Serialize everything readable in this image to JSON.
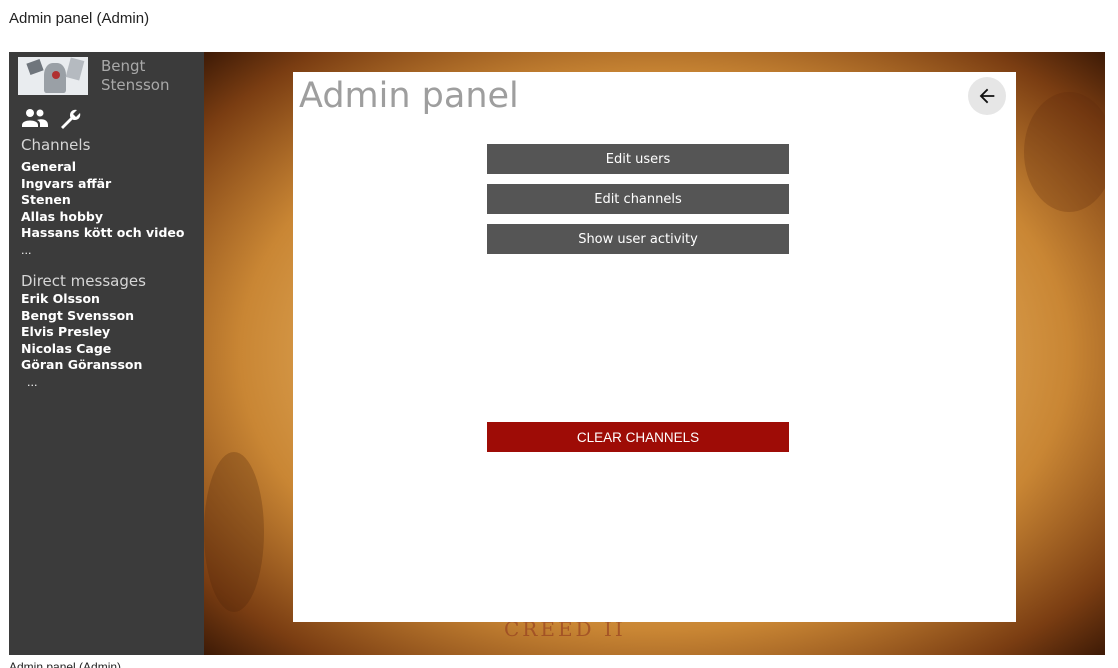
{
  "page_caption": "Admin panel (Admin)",
  "footer_caption": "Admin panel (Admin)",
  "sidebar": {
    "user_name_line1": "Bengt",
    "user_name_line2": "Stensson",
    "tool_icons": [
      "users-icon",
      "wrench-icon"
    ],
    "channels_heading": "Channels",
    "channels": [
      "General",
      "Ingvars affär",
      "Stenen",
      "Allas hobby",
      "Hassans kött och video",
      "..."
    ],
    "dm_heading": "Direct messages",
    "direct_messages": [
      "Erik Olsson",
      "Bengt Svensson",
      "Elvis Presley",
      "Nicolas Cage",
      "Göran Göransson",
      "..."
    ]
  },
  "main": {
    "watermark_text": "CREED II",
    "panel": {
      "title": "Admin panel",
      "back_icon": "arrow-left-icon",
      "buttons": {
        "edit_users": "Edit users",
        "edit_channels": "Edit channels",
        "show_user_activity": "Show user activity",
        "clear_channels": "CLEAR CHANNELS"
      }
    }
  },
  "colors": {
    "sidebar_bg": "#3b3b3b",
    "button_bg": "#555555",
    "danger_bg": "#9e0c06",
    "title_color": "#9e9e9e"
  }
}
